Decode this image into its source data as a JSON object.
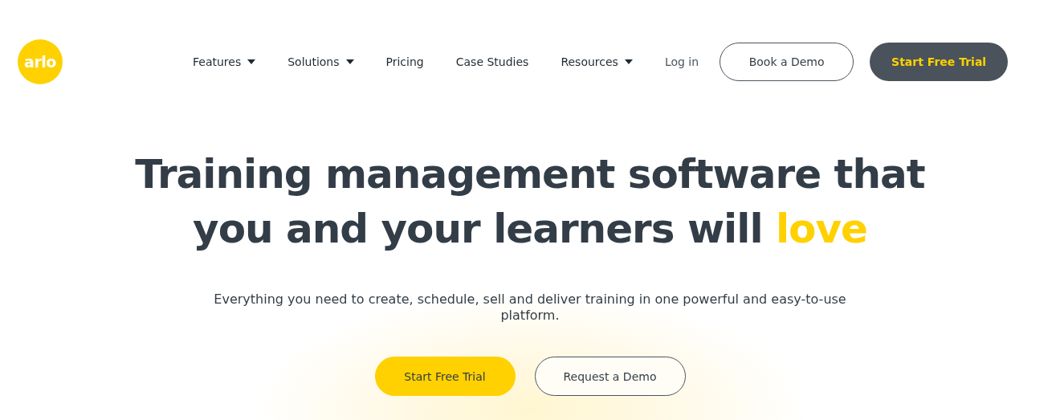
{
  "logo": {
    "text": "arlo"
  },
  "nav": [
    {
      "label": "Features",
      "dropdown": true
    },
    {
      "label": "Solutions",
      "dropdown": true
    },
    {
      "label": "Pricing",
      "dropdown": false
    },
    {
      "label": "Case Studies",
      "dropdown": false
    },
    {
      "label": "Resources",
      "dropdown": true
    }
  ],
  "login": "Log in",
  "book_demo": "Book a Demo",
  "start_trial_header": "Start Free Trial",
  "hero": {
    "headline": "Training management software that you and your learners will",
    "highlight": "love",
    "subtitle": "Everything you need to create, schedule, sell and deliver training in one powerful and easy-to-use platform.",
    "primary_button": "Start Free Trial",
    "secondary_button": "Request a Demo"
  }
}
